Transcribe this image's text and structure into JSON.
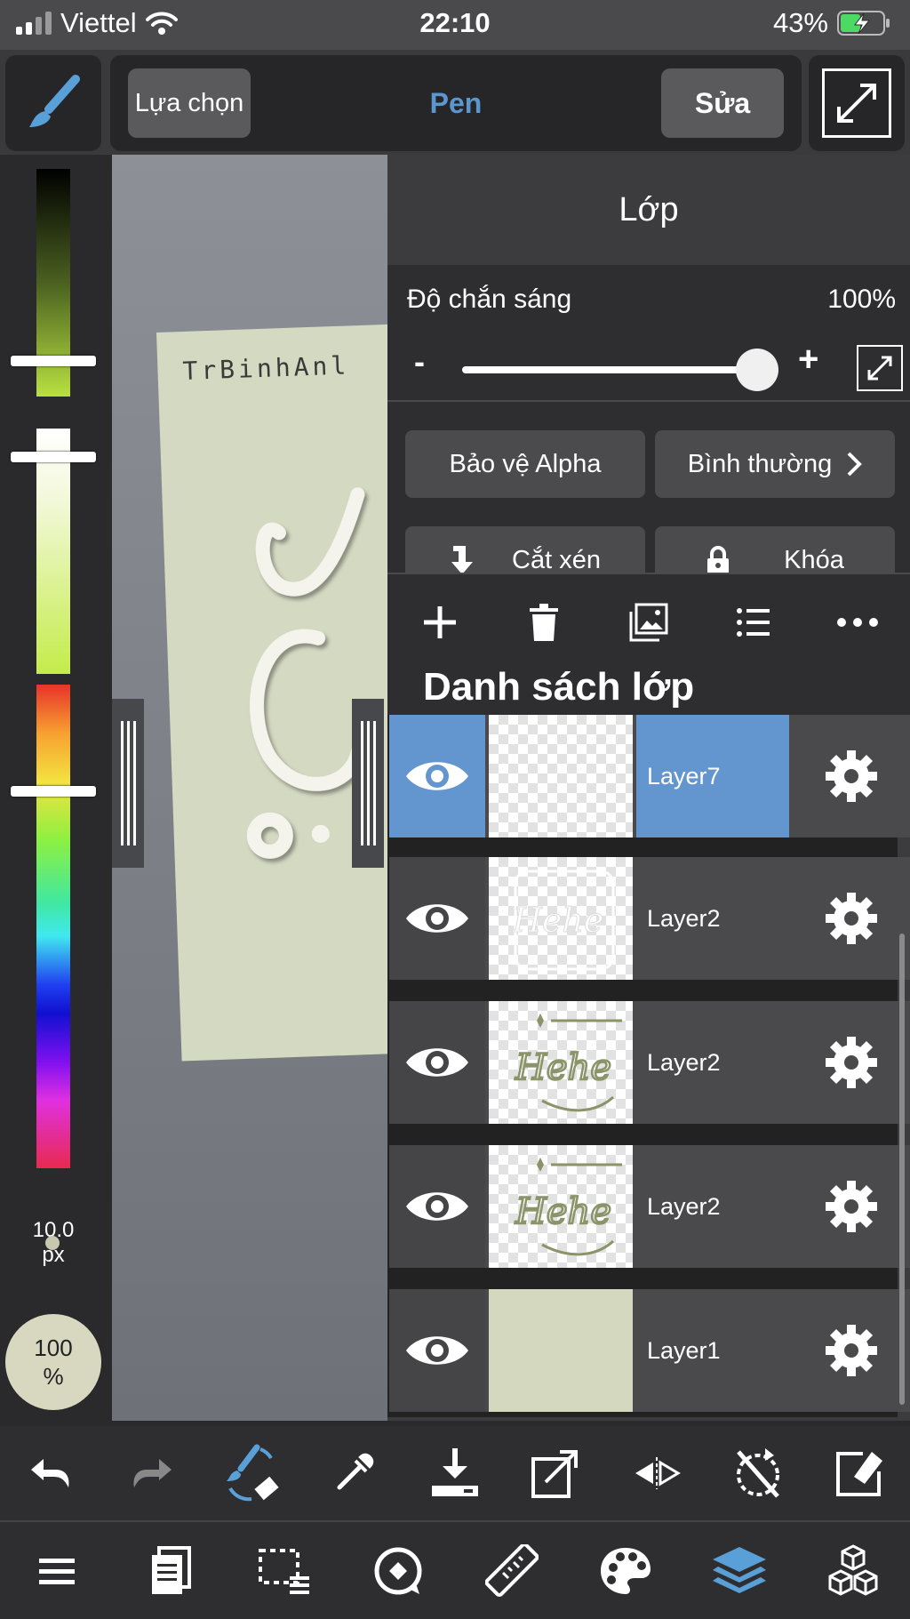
{
  "status_bar": {
    "carrier": "Viettel",
    "time": "22:10",
    "battery_percent": "43%"
  },
  "top_toolbar": {
    "selection_label": "Lựa chọn",
    "tool_name": "Pen",
    "edit_label": "Sửa"
  },
  "left_panel": {
    "brush_size_value": "10.0",
    "brush_size_unit": "px",
    "opacity_value": "100",
    "opacity_unit": "%"
  },
  "canvas": {
    "paper_text": "TrBinhAnl"
  },
  "layer_panel": {
    "title": "Lớp",
    "opacity_label": "Độ chắn sáng",
    "opacity_value": "100%",
    "opacity_fraction": 1.0,
    "minus_label": "-",
    "plus_label": "+",
    "alpha_protect_label": "Bảo vệ Alpha",
    "blend_mode_label": "Bình thường",
    "clipping_label": "Cắt xén",
    "lock_label": "Khóa",
    "list_header": "Danh sách lớp",
    "layers": [
      {
        "name": "Layer7",
        "selected": true,
        "thumb": "empty"
      },
      {
        "name": "Layer2",
        "selected": false,
        "thumb": "white-hehe"
      },
      {
        "name": "Layer2",
        "selected": false,
        "thumb": "green-hehe"
      },
      {
        "name": "Layer2",
        "selected": false,
        "thumb": "green-hehe"
      },
      {
        "name": "Layer1",
        "selected": false,
        "thumb": "solid"
      }
    ]
  },
  "thumb_text": "Hehe",
  "colors": {
    "accent": "#6396cf",
    "pen_title": "#5b96cf",
    "paper": "#d4d9c2"
  }
}
